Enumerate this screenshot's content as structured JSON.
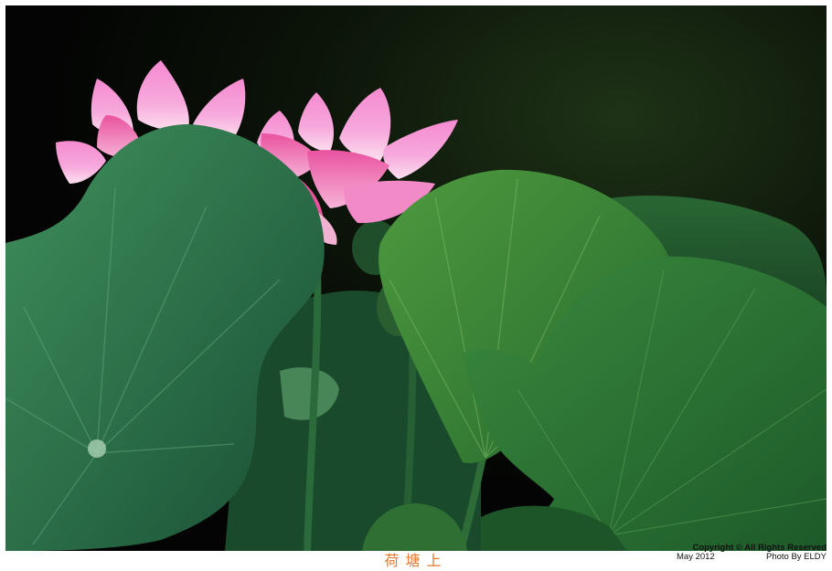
{
  "photo": {
    "subject": "lotus-flowers-and-leaves",
    "colors": {
      "background": "#050806",
      "petal": "#f07bc2",
      "petal_light": "#f9bde0",
      "leaf": "#2f7a45",
      "leaf_dark": "#11402a"
    }
  },
  "footer": {
    "caption": "荷塘上",
    "copyright": "Copyright © All Rights Reserved",
    "date": "May 2012",
    "credit": "Photo By ELDY"
  }
}
